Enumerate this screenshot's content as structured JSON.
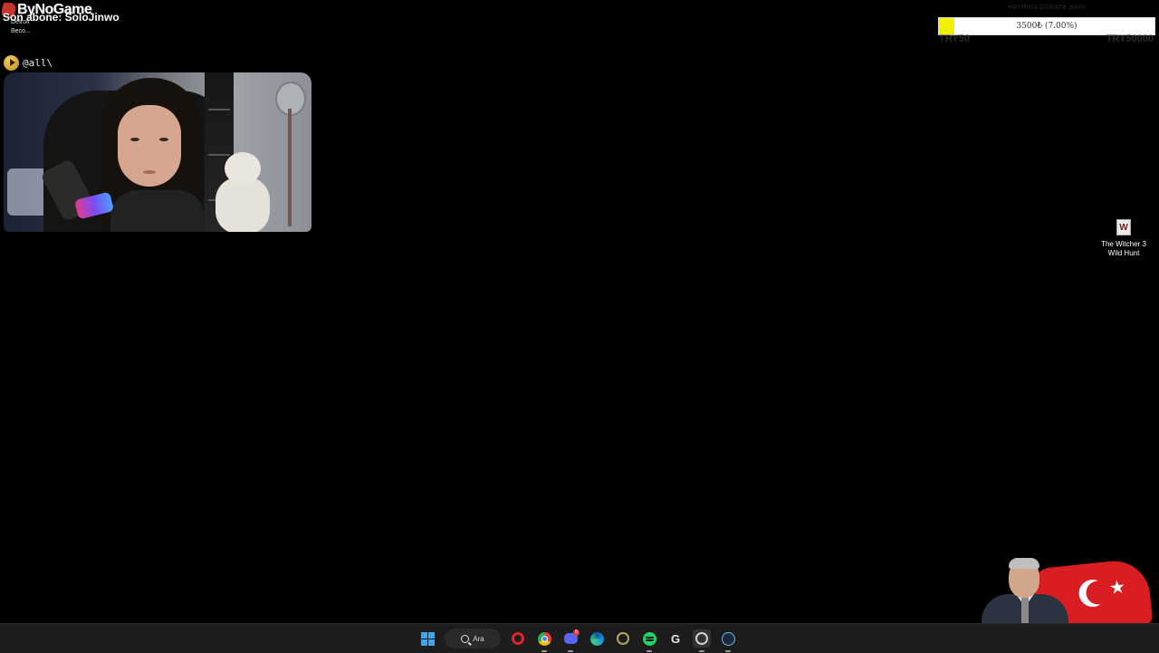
{
  "overlay": {
    "brand": "ByNoGame",
    "last_sub": "Son abone: SoloJinwo",
    "desktop_icon_label_line1": "Detroit",
    "desktop_icon_label_line2": "Beco..."
  },
  "chat": {
    "message": "@all\\"
  },
  "donation": {
    "title": "HAYRINA DONATE BARI",
    "progress_text": "3500₺ (7.00%)",
    "progress_fraction": 0.07,
    "min_label": "TRY50",
    "max_label": "TRY50000",
    "fill_color": "#f2f200"
  },
  "desktop": {
    "icon_glyph": "W",
    "icon_label_line1": "The Witcher 3",
    "icon_label_line2": "Wild Hunt"
  },
  "taskbar": {
    "search_label": "Ara",
    "icons": [
      "windows-start-icon",
      "search-icon",
      "opera-icon",
      "chrome-icon",
      "discord-icon",
      "edge-icon",
      "app-icon",
      "spotify-icon",
      "logitech-ghub-icon",
      "obs-icon",
      "steam-icon"
    ],
    "discord_badge": "9",
    "ghub_glyph": "G"
  },
  "colors": {
    "windows_blue": "#3ba6f5",
    "flag_red": "#d81e22"
  }
}
